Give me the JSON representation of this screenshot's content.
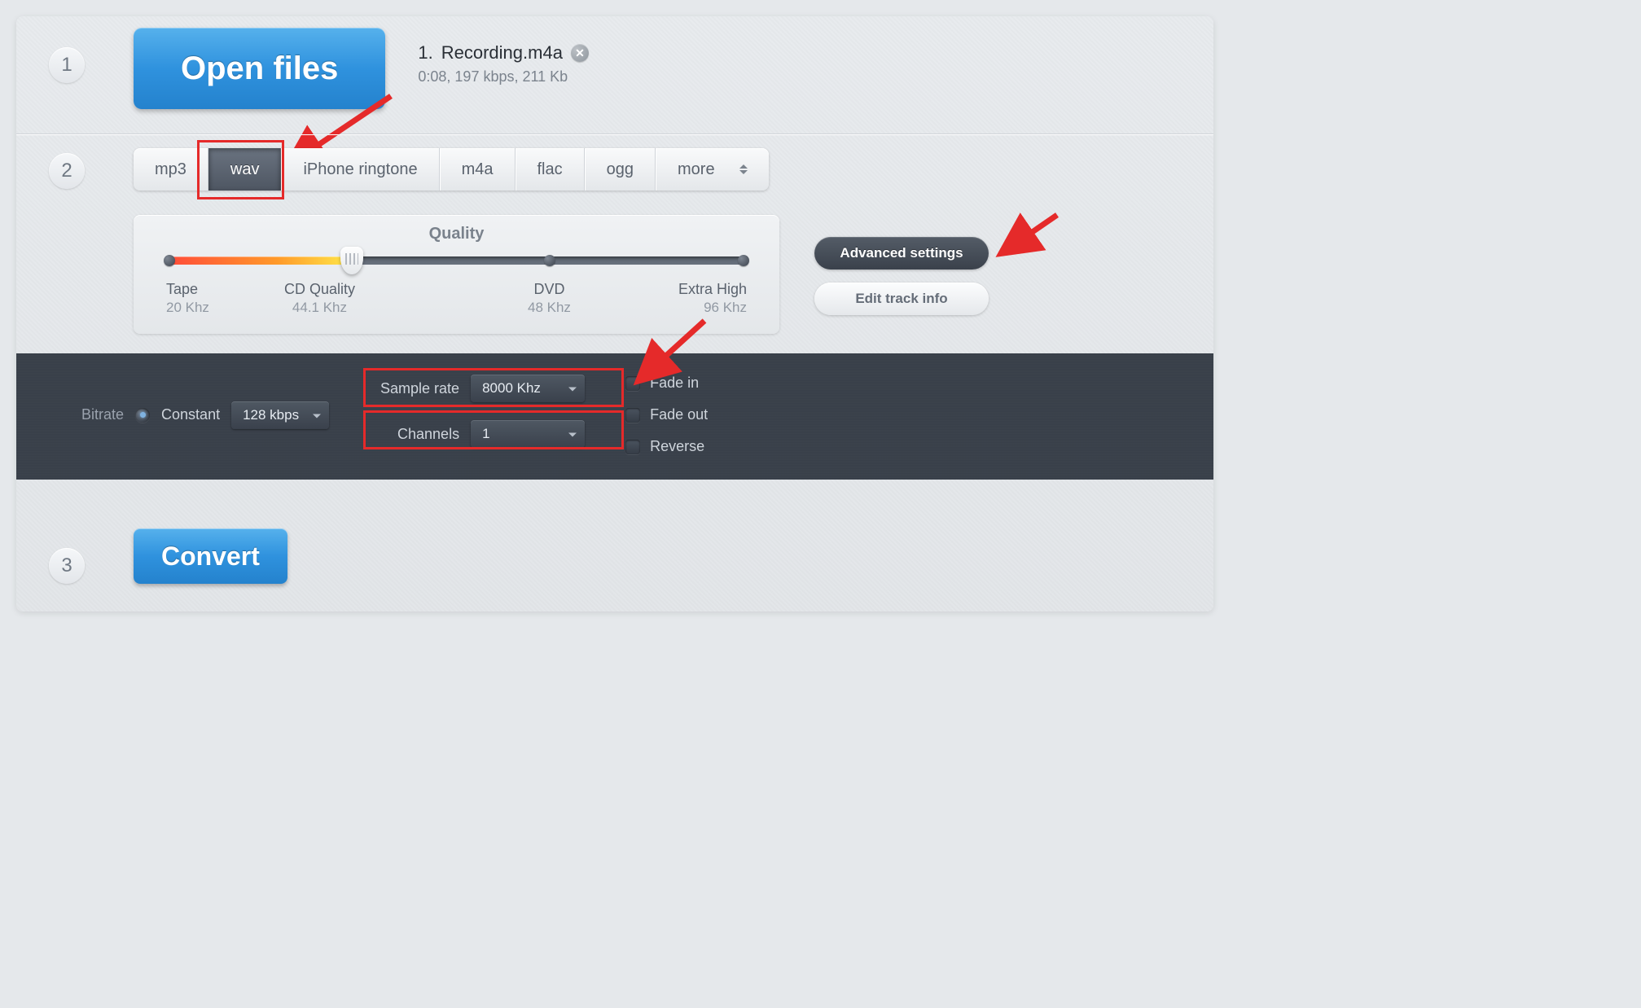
{
  "steps": {
    "one": "1",
    "two": "2",
    "three": "3"
  },
  "open_files_label": "Open files",
  "file": {
    "index": "1.",
    "name": "Recording.m4a",
    "meta": "0:08, 197 kbps, 211 Kb"
  },
  "formats": {
    "mp3": "mp3",
    "wav": "wav",
    "iphone": "iPhone ringtone",
    "m4a": "m4a",
    "flac": "flac",
    "ogg": "ogg",
    "more": "more"
  },
  "quality": {
    "title": "Quality",
    "tape": {
      "label": "Tape",
      "sub": "20 Khz"
    },
    "cd": {
      "label": "CD Quality",
      "sub": "44.1 Khz"
    },
    "dvd": {
      "label": "DVD",
      "sub": "48 Khz"
    },
    "extra": {
      "label": "Extra High",
      "sub": "96 Khz"
    }
  },
  "side": {
    "advanced": "Advanced settings",
    "edit_track": "Edit track info"
  },
  "advanced": {
    "bitrate_label": "Bitrate",
    "bitrate_mode": "Constant",
    "bitrate_value": "128 kbps",
    "sample_rate_label": "Sample rate",
    "sample_rate_value": "8000 Khz",
    "channels_label": "Channels",
    "channels_value": "1",
    "fade_in": "Fade in",
    "fade_out": "Fade out",
    "reverse": "Reverse"
  },
  "convert_label": "Convert"
}
